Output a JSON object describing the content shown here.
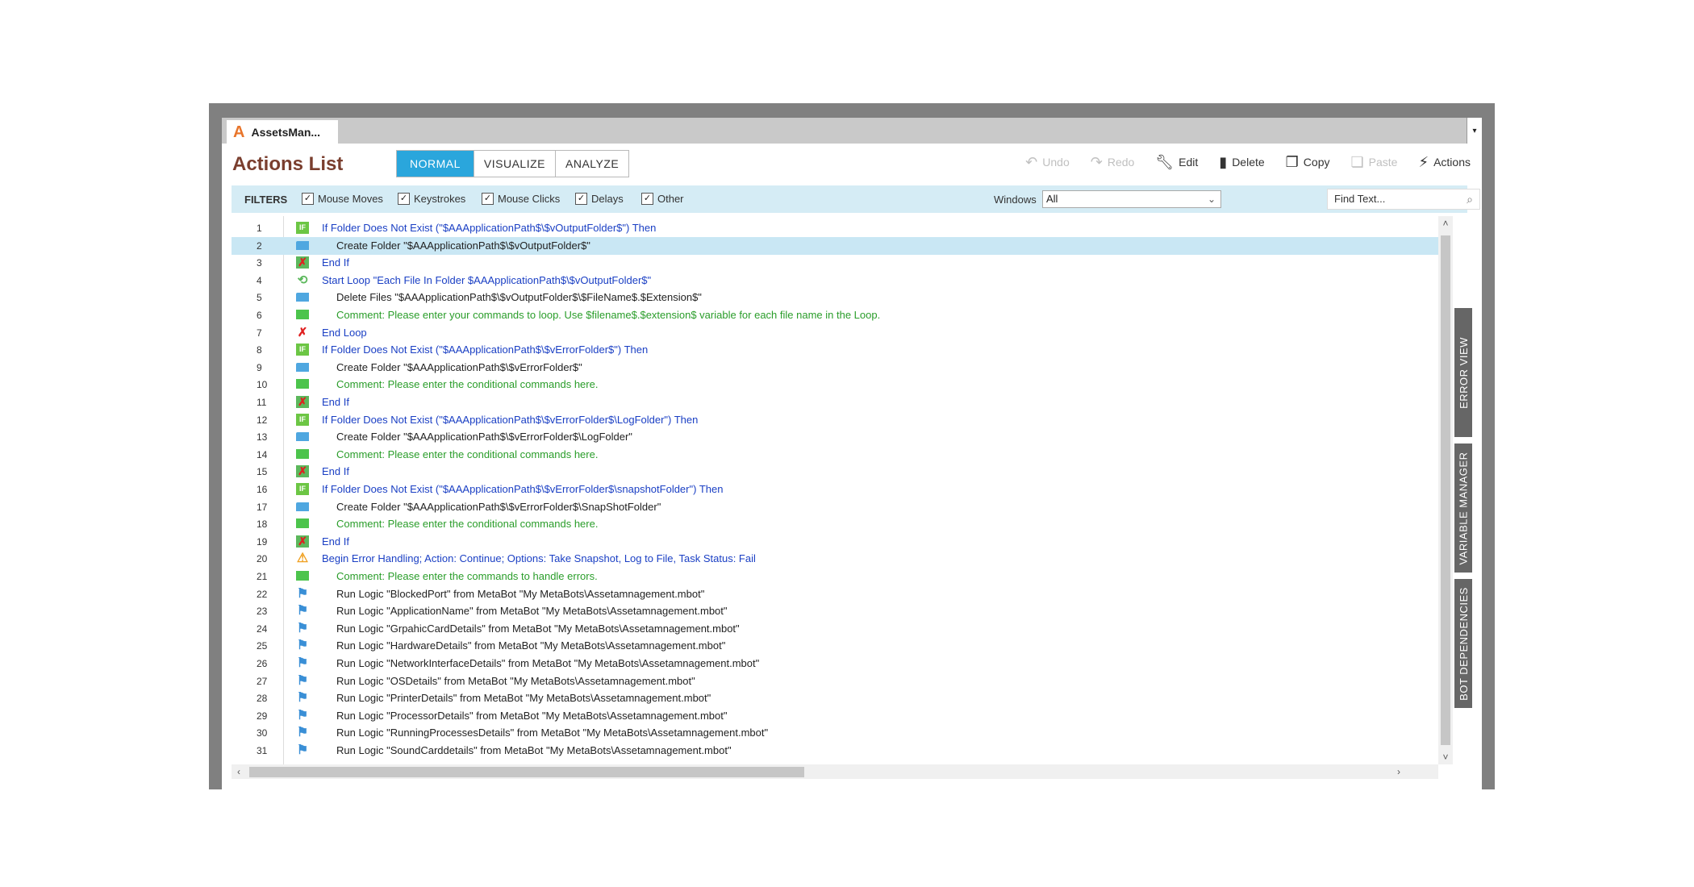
{
  "window": {
    "tab_title": "AssetsMan...",
    "logo": "A"
  },
  "header": {
    "title": "Actions List",
    "modes": [
      "NORMAL",
      "VISUALIZE",
      "ANALYZE"
    ],
    "toolbar": {
      "undo": "Undo",
      "redo": "Redo",
      "edit": "Edit",
      "delete": "Delete",
      "copy": "Copy",
      "paste": "Paste",
      "actions": "Actions"
    }
  },
  "filters": {
    "label": "FILTERS",
    "items": [
      "Mouse Moves",
      "Keystrokes",
      "Mouse Clicks",
      "Delays",
      "Other"
    ],
    "windows_label": "Windows",
    "windows_value": "All",
    "find_placeholder": "Find Text..."
  },
  "side_tabs": [
    "ERROR VIEW",
    "VARIABLE MANAGER",
    "BOT DEPENDENCIES"
  ],
  "actions": [
    {
      "n": "1",
      "icon": "if",
      "level": 0,
      "color": "blue",
      "text": "If Folder Does Not Exist (\"$AAApplicationPath$\\$vOutputFolder$\")  Then"
    },
    {
      "n": "2",
      "icon": "folder",
      "level": 1,
      "color": "black",
      "text": "Create Folder \"$AAApplicationPath$\\$vOutputFolder$\""
    },
    {
      "n": "3",
      "icon": "endif",
      "level": 0,
      "color": "blue",
      "text": "End If"
    },
    {
      "n": "4",
      "icon": "loop",
      "level": 0,
      "color": "blue",
      "text": "Start Loop \"Each File In Folder $AAApplicationPath$\\$vOutputFolder$\""
    },
    {
      "n": "5",
      "icon": "folder",
      "level": 1,
      "color": "black",
      "text": "Delete Files \"$AAApplicationPath$\\$vOutputFolder$\\$FileName$.$Extension$\""
    },
    {
      "n": "6",
      "icon": "comment",
      "level": 1,
      "color": "green",
      "text": "Comment: Please enter your commands to loop. Use $filename$.$extension$ variable for each file name in the Loop."
    },
    {
      "n": "7",
      "icon": "endloop",
      "level": 0,
      "color": "blue",
      "text": "End Loop"
    },
    {
      "n": "8",
      "icon": "if",
      "level": 0,
      "color": "blue",
      "text": "If Folder Does Not Exist (\"$AAApplicationPath$\\$vErrorFolder$\")  Then"
    },
    {
      "n": "9",
      "icon": "folder",
      "level": 1,
      "color": "black",
      "text": "Create Folder \"$AAApplicationPath$\\$vErrorFolder$\""
    },
    {
      "n": "10",
      "icon": "comment",
      "level": 1,
      "color": "green",
      "text": "Comment: Please enter the conditional commands here."
    },
    {
      "n": "11",
      "icon": "endif",
      "level": 0,
      "color": "blue",
      "text": "End If"
    },
    {
      "n": "12",
      "icon": "if",
      "level": 0,
      "color": "blue",
      "text": "If Folder Does Not Exist (\"$AAApplicationPath$\\$vErrorFolder$\\LogFolder\")  Then"
    },
    {
      "n": "13",
      "icon": "folder",
      "level": 1,
      "color": "black",
      "text": "Create Folder \"$AAApplicationPath$\\$vErrorFolder$\\LogFolder\""
    },
    {
      "n": "14",
      "icon": "comment",
      "level": 1,
      "color": "green",
      "text": "Comment: Please enter the conditional commands here."
    },
    {
      "n": "15",
      "icon": "endif",
      "level": 0,
      "color": "blue",
      "text": "End If"
    },
    {
      "n": "16",
      "icon": "if",
      "level": 0,
      "color": "blue",
      "text": "If Folder Does Not Exist (\"$AAApplicationPath$\\$vErrorFolder$\\snapshotFolder\")  Then"
    },
    {
      "n": "17",
      "icon": "folder",
      "level": 1,
      "color": "black",
      "text": "Create Folder \"$AAApplicationPath$\\$vErrorFolder$\\SnapShotFolder\""
    },
    {
      "n": "18",
      "icon": "comment",
      "level": 1,
      "color": "green",
      "text": "Comment: Please enter the conditional commands here."
    },
    {
      "n": "19",
      "icon": "endif",
      "level": 0,
      "color": "blue",
      "text": "End If"
    },
    {
      "n": "20",
      "icon": "warn",
      "level": 0,
      "color": "blue",
      "text": "Begin Error Handling; Action: Continue; Options: Take Snapshot, Log to File,  Task Status: Fail"
    },
    {
      "n": "21",
      "icon": "comment",
      "level": 1,
      "color": "green",
      "text": "Comment: Please enter the commands to handle errors."
    },
    {
      "n": "22",
      "icon": "logic",
      "level": 1,
      "color": "black",
      "text": "Run Logic \"BlockedPort\" from MetaBot \"My MetaBots\\Assetamnagement.mbot\""
    },
    {
      "n": "23",
      "icon": "logic",
      "level": 1,
      "color": "black",
      "text": "Run Logic \"ApplicationName\" from MetaBot \"My MetaBots\\Assetamnagement.mbot\""
    },
    {
      "n": "24",
      "icon": "logic",
      "level": 1,
      "color": "black",
      "text": "Run Logic \"GrpahicCardDetails\" from MetaBot \"My MetaBots\\Assetamnagement.mbot\""
    },
    {
      "n": "25",
      "icon": "logic",
      "level": 1,
      "color": "black",
      "text": "Run Logic \"HardwareDetails\" from MetaBot \"My MetaBots\\Assetamnagement.mbot\""
    },
    {
      "n": "26",
      "icon": "logic",
      "level": 1,
      "color": "black",
      "text": "Run Logic \"NetworkInterfaceDetails\" from MetaBot \"My MetaBots\\Assetamnagement.mbot\""
    },
    {
      "n": "27",
      "icon": "logic",
      "level": 1,
      "color": "black",
      "text": "Run Logic \"OSDetails\" from MetaBot \"My MetaBots\\Assetamnagement.mbot\""
    },
    {
      "n": "28",
      "icon": "logic",
      "level": 1,
      "color": "black",
      "text": "Run Logic \"PrinterDetails\" from MetaBot \"My MetaBots\\Assetamnagement.mbot\""
    },
    {
      "n": "29",
      "icon": "logic",
      "level": 1,
      "color": "black",
      "text": "Run Logic \"ProcessorDetails\" from MetaBot \"My MetaBots\\Assetamnagement.mbot\""
    },
    {
      "n": "30",
      "icon": "logic",
      "level": 1,
      "color": "black",
      "text": "Run Logic \"RunningProcessesDetails\" from MetaBot \"My MetaBots\\Assetamnagement.mbot\""
    },
    {
      "n": "31",
      "icon": "logic",
      "level": 1,
      "color": "black",
      "text": "Run Logic \"SoundCarddetails\" from MetaBot \"My MetaBots\\Assetamnagement.mbot\""
    }
  ],
  "selected_row": "2"
}
